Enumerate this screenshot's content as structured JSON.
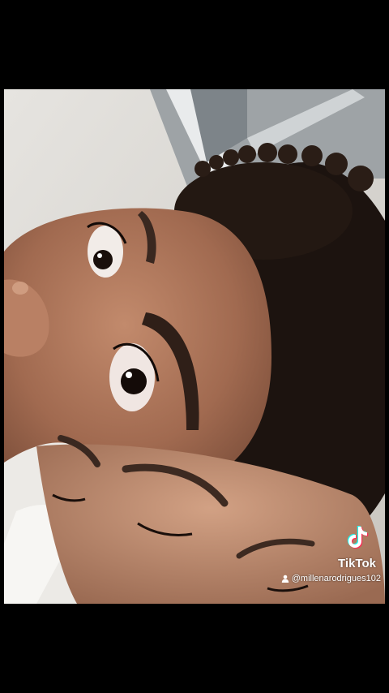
{
  "watermark": {
    "brand": "TikTok",
    "username": "@millenarodrigues102",
    "icons": [
      "tiktok-logo-icon",
      "user-icon"
    ]
  },
  "colors": {
    "background": "#000000",
    "skin": "#a86f55",
    "hair": "#1c130f",
    "wall": "#d8d6d2"
  }
}
